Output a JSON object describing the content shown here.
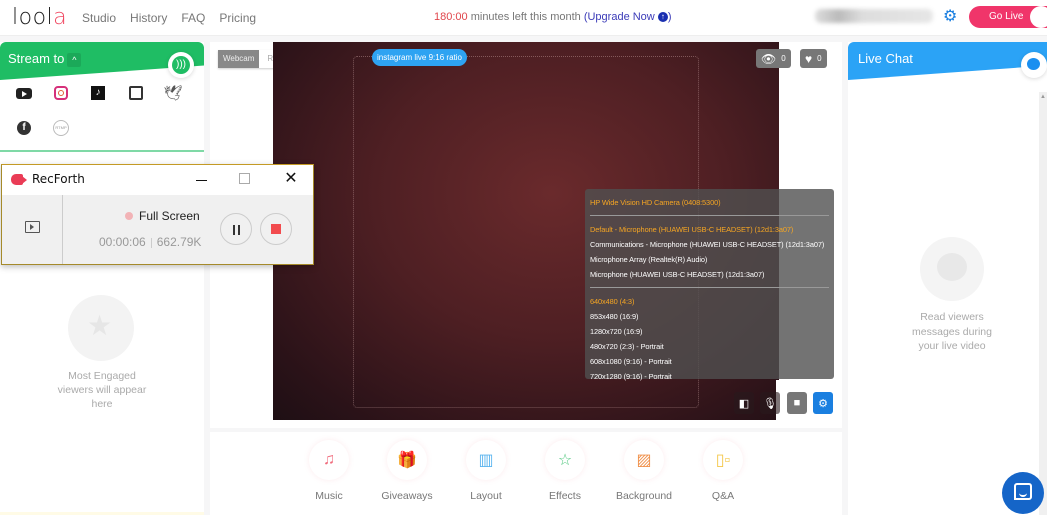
{
  "topbar": {
    "logo": "loola",
    "nav": [
      "Studio",
      "History",
      "FAQ",
      "Pricing"
    ],
    "minutes_value": "180:00",
    "minutes_text": " minutes left this month ",
    "upgrade_label": "(Upgrade Now",
    "upgrade_close": ")",
    "go_live_label": "Go Live"
  },
  "left_panel": {
    "title": "Stream to",
    "platforms": [
      "YouTube",
      "Instagram",
      "TikTok",
      "Twitch",
      "Twitter",
      "Facebook",
      "RTMP"
    ],
    "rtmp_icon_text": "RTMP",
    "engaged_text": "Most Engaged viewers will appear here"
  },
  "recorder": {
    "app_name": "RecForth",
    "mode": "Full Screen",
    "elapsed": "00:00:06",
    "size": "662.79K"
  },
  "studio": {
    "source_toggle": [
      "Webcam",
      "RTMP"
    ],
    "active_source": "Webcam",
    "ratio_pill": "instagram live 9:16 ratio",
    "views_count": "0",
    "likes_count": "0",
    "settings_menu": {
      "camera": "HP Wide Vision HD Camera (0408:5300)",
      "microphones": [
        {
          "label": "Default - Microphone (HUAWEI USB-C HEADSET) (12d1:3a07)",
          "selected": true
        },
        {
          "label": "Communications - Microphone (HUAWEI USB-C HEADSET) (12d1:3a07)",
          "selected": false
        },
        {
          "label": "Microphone Array (Realtek(R) Audio)",
          "selected": false
        },
        {
          "label": "Microphone (HUAWEI USB-C HEADSET) (12d1:3a07)",
          "selected": false
        }
      ],
      "resolutions": [
        {
          "label": "640x480 (4:3)",
          "selected": true
        },
        {
          "label": "853x480 (16:9)",
          "selected": false
        },
        {
          "label": "1280x720 (16:9)",
          "selected": false
        },
        {
          "label": "480x720 (2:3) - Portrait",
          "selected": false
        },
        {
          "label": "608x1080 (9:16) - Portrait",
          "selected": false
        },
        {
          "label": "720x1280 (9:16) - Portrait",
          "selected": false
        }
      ]
    }
  },
  "tools": [
    {
      "label": "Music",
      "icon": "music-icon",
      "color": "#f06b7c"
    },
    {
      "label": "Giveaways",
      "icon": "gift-icon",
      "color": "#e26ad6"
    },
    {
      "label": "Layout",
      "icon": "layout-icon",
      "color": "#5bb4ef"
    },
    {
      "label": "Effects",
      "icon": "star-icon",
      "color": "#4fc77d"
    },
    {
      "label": "Background",
      "icon": "image-icon",
      "color": "#f0904a"
    },
    {
      "label": "Q&A",
      "icon": "qa-icon",
      "color": "#f4c74a"
    }
  ],
  "chat": {
    "title": "Live Chat",
    "empty_text": "Read viewers messages during your live video"
  },
  "colors": {
    "stream_green": "#1fbd64",
    "chat_blue": "#2ba3f6",
    "go_live": "#f0356a",
    "selected_orange": "#f6a623"
  }
}
